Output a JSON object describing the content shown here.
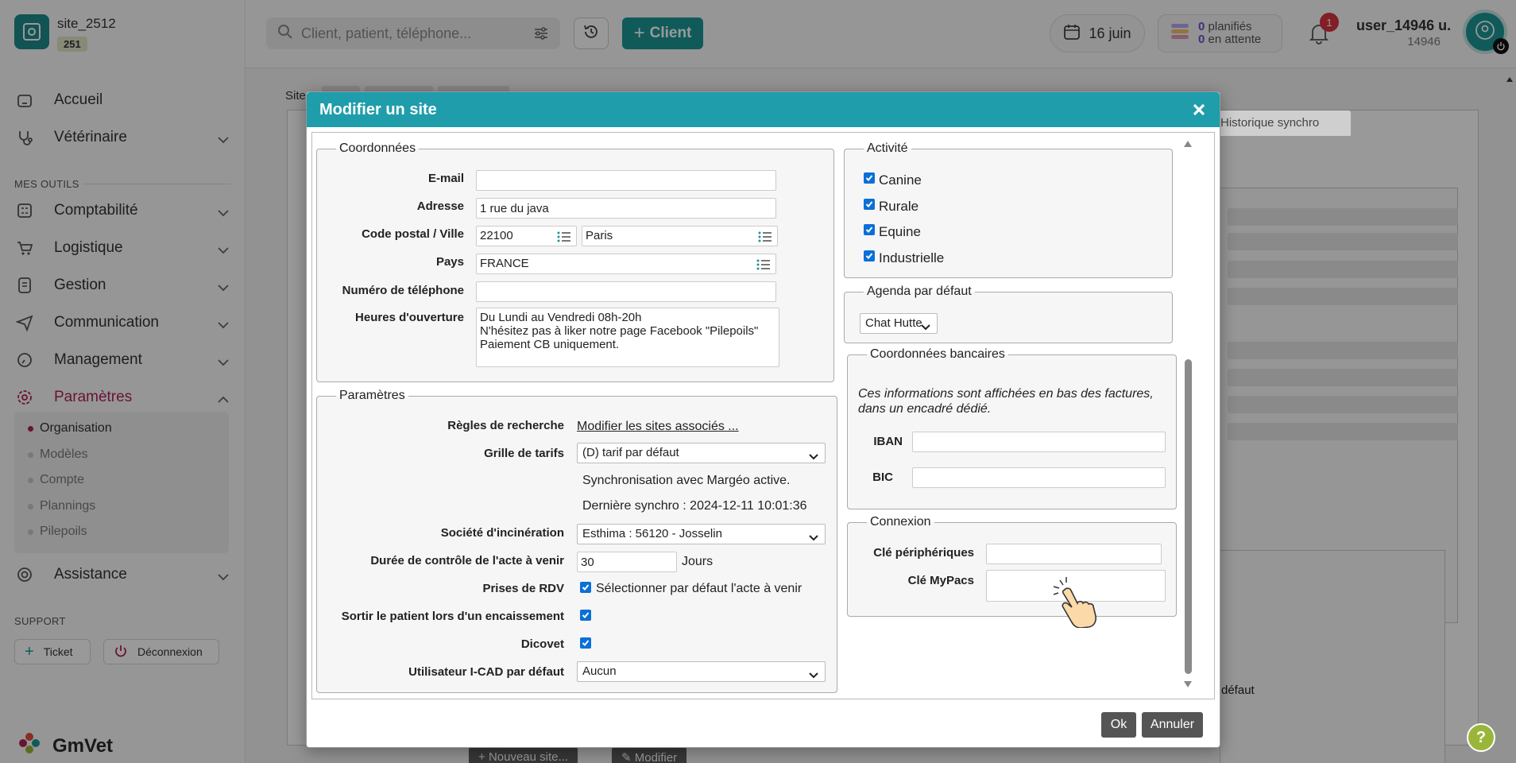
{
  "sidebar": {
    "site_name": "site_2512",
    "site_badge": "251",
    "nav": [
      {
        "label": "Accueil"
      },
      {
        "label": "Vétérinaire"
      },
      {
        "label": "Comptabilité"
      },
      {
        "label": "Logistique"
      },
      {
        "label": "Gestion"
      },
      {
        "label": "Communication"
      },
      {
        "label": "Management"
      },
      {
        "label": "Paramètres"
      },
      {
        "label": "Assistance"
      }
    ],
    "section_tools": "MES OUTILS",
    "section_support": "SUPPORT",
    "subnav": [
      "Organisation",
      "Modèles",
      "Compte",
      "Plannings",
      "Pilepoils"
    ],
    "ticket_label": "Ticket",
    "logout_label": "Déconnexion",
    "brand": "GmVet"
  },
  "topbar": {
    "search_placeholder": "Client, patient, téléphone...",
    "client_button": "Client",
    "date": "16 juin",
    "planned_count": "0",
    "planned_label": "planifiés",
    "pending_count": "0",
    "pending_label": "en attente",
    "notif_count": "1",
    "user_name": "user_14946 u.",
    "user_id": "14946"
  },
  "background": {
    "tab_site": "Site",
    "tab_history": "Historique synchro",
    "new_site_button": "Nouveau site...",
    "edit_button": "Modifier",
    "default_label": "défaut"
  },
  "modal": {
    "title": "Modifier un site",
    "coordonnees": {
      "legend": "Coordonnées",
      "email_label": "E-mail",
      "email_value": "",
      "address_label": "Adresse",
      "address_value": "1 rue du java",
      "zip_city_label": "Code postal / Ville",
      "zip_value": "22100",
      "city_value": "Paris",
      "country_label": "Pays",
      "country_value": "FRANCE",
      "phone_label": "Numéro de téléphone",
      "phone_value": "",
      "hours_label": "Heures d'ouverture",
      "hours_value": "Du Lundi au Vendredi 08h-20h\nN'hésitez pas à liker notre page Facebook \"Pilepoils\"\nPaiement CB uniquement."
    },
    "parametres": {
      "legend": "Paramètres",
      "search_rules_label": "Règles de recherche",
      "search_rules_link": "Modifier les sites associés ...",
      "price_grid_label": "Grille de tarifs",
      "price_grid_value": "(D) tarif par défaut",
      "sync_text": "Synchronisation avec Margéo active.",
      "last_sync_text": "Dernière synchro : 2024-12-11 10:01:36",
      "incineration_label": "Société d'incinération",
      "incineration_value": "Esthima : 56120 - Josselin",
      "control_duration_label": "Durée de contrôle de l'acte à venir",
      "control_duration_value": "30",
      "control_duration_unit": "Jours",
      "rdv_label": "Prises de RDV",
      "rdv_checkbox_label": "Sélectionner par défaut l'acte à venir",
      "exit_patient_label": "Sortir le patient lors d'un encaissement",
      "dicovet_label": "Dicovet",
      "icad_label": "Utilisateur I-CAD par défaut",
      "icad_value": "Aucun"
    },
    "activite": {
      "legend": "Activité",
      "items": [
        "Canine",
        "Rurale",
        "Equine",
        "Industrielle"
      ]
    },
    "agenda": {
      "legend": "Agenda par défaut",
      "value": "Chat Hutte"
    },
    "banque": {
      "legend": "Coordonnées bancaires",
      "note": "Ces informations sont affichées en bas des factures, dans un encadré dédié.",
      "iban_label": "IBAN",
      "iban_value": "",
      "bic_label": "BIC",
      "bic_value": ""
    },
    "connexion": {
      "legend": "Connexion",
      "peripherals_label": "Clé périphériques",
      "peripherals_value": "",
      "mypacs_label": "Clé MyPacs",
      "mypacs_value": ""
    },
    "ok_label": "Ok",
    "cancel_label": "Annuler"
  },
  "colors": {
    "teal": "#1d9696",
    "modal_header": "#1f9dab",
    "accent_magenta": "#b0215b",
    "checkbox_blue": "#0b6fd8"
  }
}
